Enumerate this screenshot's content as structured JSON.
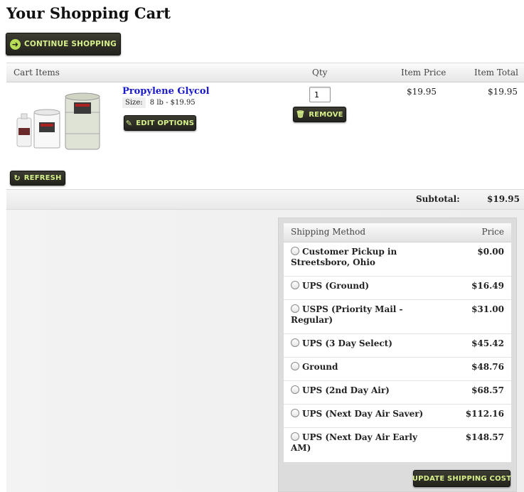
{
  "page": {
    "title": "Your Shopping Cart"
  },
  "buttons": {
    "continue": "CONTINUE SHOPPING",
    "edit": "EDIT OPTIONS",
    "remove": "REMOVE",
    "refresh": "REFRESH",
    "update_shipping": "UPDATE SHIPPING COST"
  },
  "cart": {
    "columns": {
      "items": "Cart Items",
      "qty": "Qty",
      "price": "Item Price",
      "total": "Item Total"
    },
    "item": {
      "name": "Propylene Glycol",
      "size_label": "Size:",
      "size_value": "8 lb - $19.95",
      "qty": "1",
      "price": "$19.95",
      "total": "$19.95"
    },
    "subtotal_label": "Subtotal:",
    "subtotal_value": "$19.95"
  },
  "shipping": {
    "header_method": "Shipping Method",
    "header_price": "Price",
    "options": [
      {
        "method": "Customer Pickup in Streetsboro, Ohio",
        "price": "$0.00"
      },
      {
        "method": "UPS (Ground)",
        "price": "$16.49"
      },
      {
        "method": "USPS (Priority Mail - Regular)",
        "price": "$31.00"
      },
      {
        "method": "UPS (3 Day Select)",
        "price": "$45.42"
      },
      {
        "method": "Ground",
        "price": "$48.76"
      },
      {
        "method": "UPS (2nd Day Air)",
        "price": "$68.57"
      },
      {
        "method": "UPS (Next Day Air Saver)",
        "price": "$112.16"
      },
      {
        "method": "UPS (Next Day Air Early AM)",
        "price": "$148.57"
      }
    ]
  },
  "colors": {
    "button_bg": "#2e2e26",
    "button_text": "#d6f08a",
    "link": "#1a1acc"
  },
  "icons": [
    "arrow-left-circle-icon",
    "pencil-icon",
    "trash-icon",
    "refresh-icon"
  ]
}
